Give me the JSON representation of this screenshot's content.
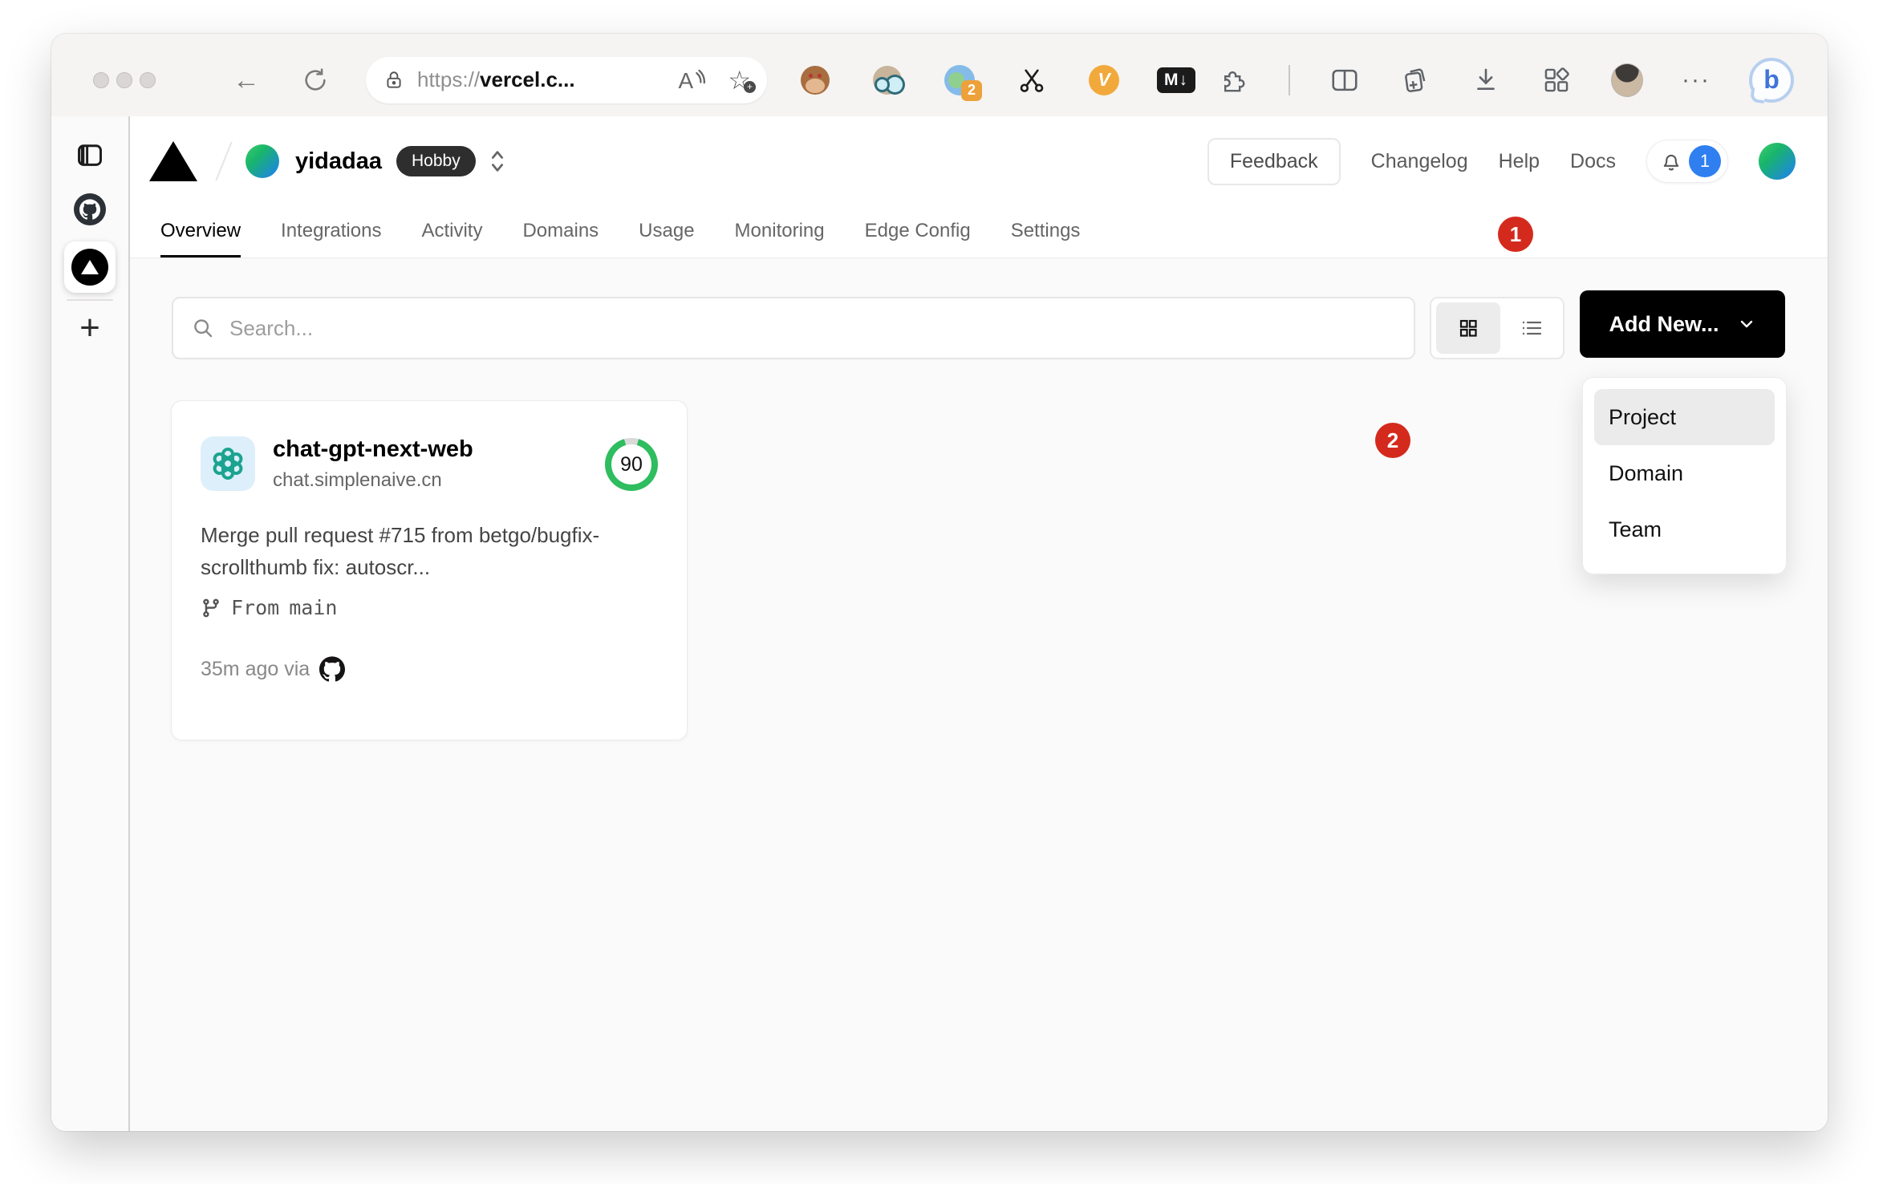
{
  "browser": {
    "url": {
      "scheme": "https://",
      "host": "vercel.c..."
    },
    "extension_badge_count": "2",
    "icons": {
      "back": "←",
      "reader_a": "A",
      "star": "☆",
      "markdown_ext": "M↓",
      "v_ext": "V",
      "more": "···",
      "bing_b": "b",
      "sidebar_plus": "+"
    }
  },
  "vercel_header": {
    "account": "yidadaa",
    "plan": "Hobby",
    "feedback": "Feedback",
    "links": [
      "Changelog",
      "Help",
      "Docs"
    ],
    "notification_count": "1"
  },
  "tabs": [
    {
      "label": "Overview",
      "active": true
    },
    {
      "label": "Integrations",
      "active": false
    },
    {
      "label": "Activity",
      "active": false
    },
    {
      "label": "Domains",
      "active": false
    },
    {
      "label": "Usage",
      "active": false
    },
    {
      "label": "Monitoring",
      "active": false
    },
    {
      "label": "Edge Config",
      "active": false
    },
    {
      "label": "Settings",
      "active": false
    }
  ],
  "toolbar": {
    "search_placeholder": "Search...",
    "add_new": "Add New..."
  },
  "dropdown": {
    "items": [
      {
        "label": "Project",
        "selected": true
      },
      {
        "label": "Domain",
        "selected": false
      },
      {
        "label": "Team",
        "selected": false
      }
    ]
  },
  "card": {
    "name": "chat-gpt-next-web",
    "domain": "chat.simplenaive.cn",
    "score": "90",
    "commit": "Merge pull request #715 from betgo/bugfix-scrollthumb fix: autoscr...",
    "branch_label": "From",
    "branch_name": "main",
    "meta": "35m ago via"
  },
  "annotations": {
    "step1": "1",
    "step2": "2"
  },
  "colors": {
    "annotation_red": "#d42a1d",
    "score_green": "#2ebd5f",
    "notification_blue": "#2f7ff0",
    "brand_black": "#000000",
    "content_bg": "#fafafa"
  }
}
